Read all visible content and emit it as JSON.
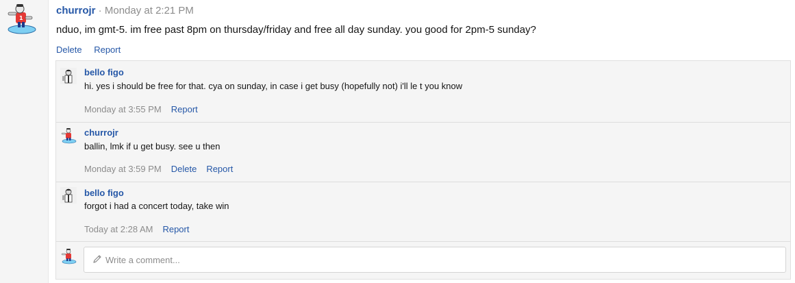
{
  "post": {
    "author": "churrojr",
    "separator": " · ",
    "time": "Monday at 2:21 PM",
    "body": "nduo, im gmt-5. im free past 8pm on thursday/friday and free all day sunday. you good for 2pm-5 sunday?",
    "actions": {
      "delete": "Delete",
      "report": "Report"
    }
  },
  "comments": [
    {
      "author": "bello figo",
      "text": "hi. yes i should be free for that. cya on sunday, in case i get busy (hopefully not) i'll le t you know",
      "time": "Monday at 3:55 PM",
      "report": "Report"
    },
    {
      "author": "churrojr",
      "text": "ballin, lmk if u get busy. see u then",
      "time": "Monday at 3:59 PM",
      "delete": "Delete",
      "report": "Report"
    },
    {
      "author": "bello figo",
      "text": "forgot i had a concert today, take win",
      "time": "Today at 2:28 AM",
      "report": "Report"
    }
  ],
  "compose": {
    "placeholder": "Write a comment..."
  },
  "colors": {
    "link": "#2557a7",
    "muted": "#8c8c8c",
    "panel": "#f5f5f5"
  }
}
